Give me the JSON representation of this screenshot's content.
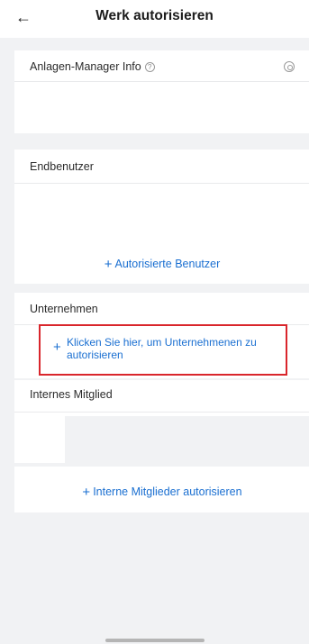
{
  "header": {
    "back_icon": "arrow-left-icon",
    "title": "Werk autorisieren"
  },
  "plant_manager": {
    "title": "Anlagen-Manager Info",
    "help_icon": "question-circle-icon",
    "settings_icon": "gear-icon"
  },
  "end_users": {
    "title": "Endbenutzer",
    "authorize_label": "Autorisierte Benutzer"
  },
  "companies": {
    "title": "Unternehmen",
    "authorize_label": "Klicken Sie hier, um Unternehmenen zu autorisieren"
  },
  "internal_members": {
    "title": "Internes Mitglied",
    "authorize_label": "Interne Mitglieder autorisieren"
  },
  "colors": {
    "accent": "#1a6fd1",
    "highlight_border": "#d9262c",
    "background": "#f1f2f4"
  }
}
